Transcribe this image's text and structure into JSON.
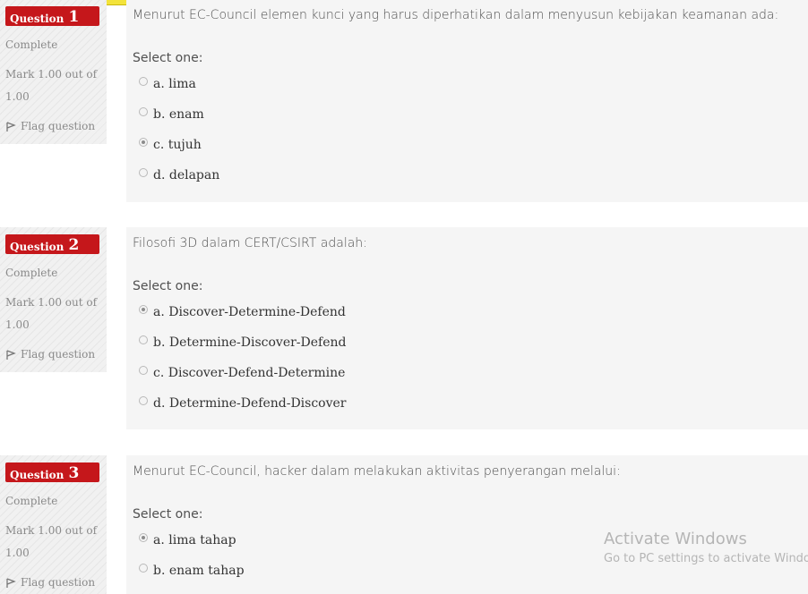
{
  "questions": [
    {
      "label": "Question",
      "number": "1",
      "state": "Complete",
      "grade_line1": "Mark 1.00 out of",
      "grade_line2": "1.00",
      "flag": "Flag question",
      "text": "Menurut EC-Council elemen kunci yang harus diperhatikan dalam menyusun kebijakan keamanan ada:",
      "prompt": "Select one:",
      "selected": 2,
      "options": [
        "a. lima",
        "b. enam",
        "c. tujuh",
        "d. delapan"
      ]
    },
    {
      "label": "Question",
      "number": "2",
      "state": "Complete",
      "grade_line1": "Mark 1.00 out of",
      "grade_line2": "1.00",
      "flag": "Flag question",
      "text": "Filosofi 3D dalam CERT/CSIRT adalah:",
      "prompt": "Select one:",
      "selected": 0,
      "options": [
        "a. Discover-Determine-Defend",
        "b. Determine-Discover-Defend",
        "c. Discover-Defend-Determine",
        "d. Determine-Defend-Discover"
      ]
    },
    {
      "label": "Question",
      "number": "3",
      "state": "Complete",
      "grade_line1": "Mark 1.00 out of",
      "grade_line2": "1.00",
      "flag": "Flag question",
      "text": "Menurut EC-Council, hacker dalam melakukan aktivitas penyerangan melalui:",
      "prompt": "Select one:",
      "selected": 0,
      "options": [
        "a. lima tahap",
        "b. enam tahap"
      ]
    }
  ],
  "watermark": {
    "line1": "Activate Windows",
    "line2": "Go to PC settings to activate Windows."
  }
}
